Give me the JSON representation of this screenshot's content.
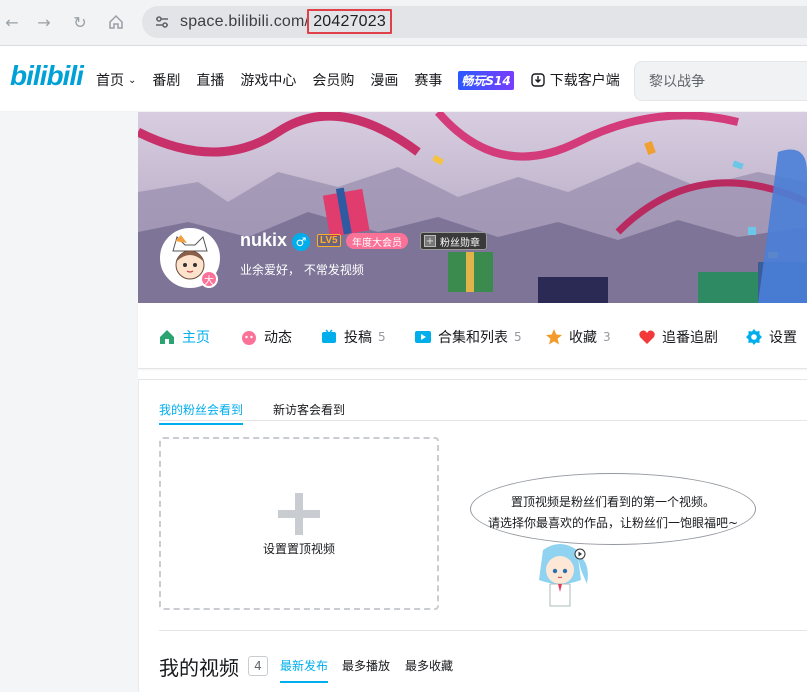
{
  "browser": {
    "url_domain": "space.bilibili.com/",
    "url_path": "20427023"
  },
  "header": {
    "logo": "bilibili",
    "nav": [
      {
        "label": "首页",
        "dropdown": true
      },
      {
        "label": "番剧"
      },
      {
        "label": "直播"
      },
      {
        "label": "游戏中心"
      },
      {
        "label": "会员购"
      },
      {
        "label": "漫画"
      },
      {
        "label": "赛事"
      },
      {
        "label": "畅玩S14"
      },
      {
        "label": "下载客户端"
      }
    ],
    "search_placeholder": "黎以战争"
  },
  "profile": {
    "name": "nukix",
    "level": "LV5",
    "vip": "年度大会员",
    "fan_badge": "粉丝勋章",
    "sign": "业余爱好， 不常发视频",
    "avatar_badge": "大"
  },
  "tabs": [
    {
      "label": "主页",
      "count": "",
      "active": true,
      "icon": "home-icon"
    },
    {
      "label": "动态",
      "count": "",
      "icon": "dynamic-icon"
    },
    {
      "label": "投稿",
      "count": "5",
      "icon": "upload-icon"
    },
    {
      "label": "合集和列表",
      "count": "5",
      "icon": "collection-icon"
    },
    {
      "label": "收藏",
      "count": "3",
      "icon": "star-icon"
    },
    {
      "label": "追番追剧",
      "count": "",
      "icon": "heart-icon"
    },
    {
      "label": "设置",
      "count": "",
      "icon": "gear-icon"
    }
  ],
  "pinned": {
    "subtabs": [
      "我的粉丝会看到",
      "新访客会看到"
    ],
    "set_label": "设置置顶视频",
    "tip_line1": "置顶视频是粉丝们看到的第一个视频。",
    "tip_line2": "请选择你最喜欢的作品，让粉丝们一饱眼福吧~"
  },
  "videos": {
    "title": "我的视频",
    "count": "4",
    "sorts": [
      "最新发布",
      "最多播放",
      "最多收藏"
    ]
  },
  "colors": {
    "accent": "#00aeec",
    "pink": "#fb7299",
    "text": "#18191c"
  }
}
